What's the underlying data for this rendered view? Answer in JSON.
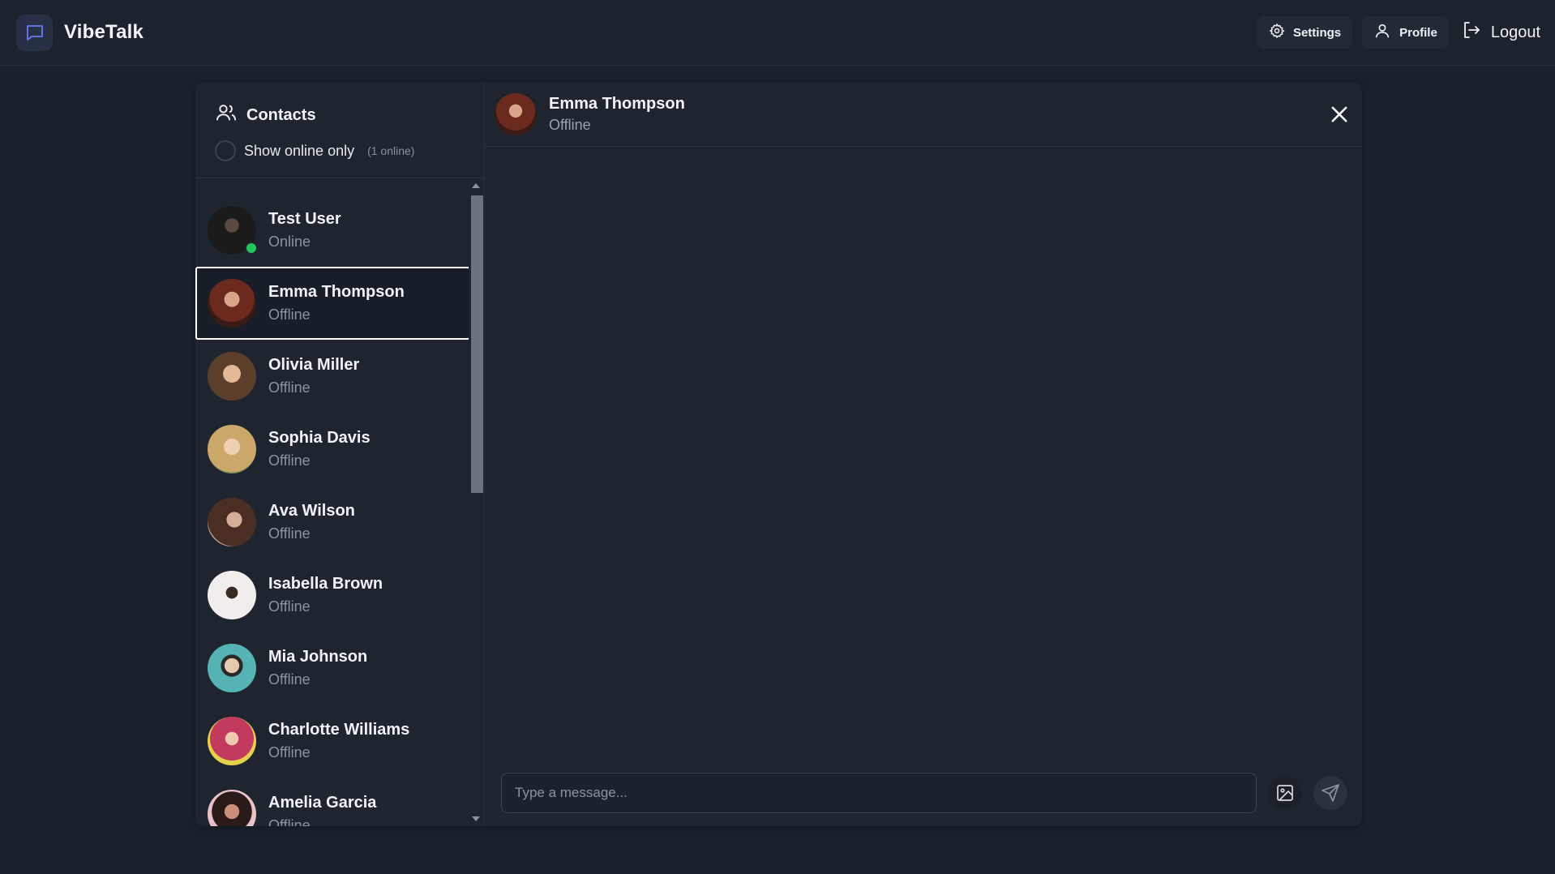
{
  "app": {
    "name": "VibeTalk",
    "accent": "#5b6cf0"
  },
  "nav": {
    "settings_label": "Settings",
    "profile_label": "Profile",
    "logout_label": "Logout"
  },
  "sidebar": {
    "title": "Contacts",
    "filter_label": "Show online only",
    "online_count": "(1 online)",
    "contacts": [
      {
        "name": "Test User",
        "status": "Online",
        "avatar_color": "#2b2b2b",
        "online": true
      },
      {
        "name": "Emma Thompson",
        "status": "Offline",
        "avatar_color": "#7a3a2a",
        "online": false
      },
      {
        "name": "Olivia Miller",
        "status": "Offline",
        "avatar_color": "#8a6a4a",
        "online": false
      },
      {
        "name": "Sophia Davis",
        "status": "Offline",
        "avatar_color": "#c9b07a",
        "online": false
      },
      {
        "name": "Ava Wilson",
        "status": "Offline",
        "avatar_color": "#5a4036",
        "online": false
      },
      {
        "name": "Isabella Brown",
        "status": "Offline",
        "avatar_color": "#e8e2e2",
        "online": false
      },
      {
        "name": "Mia Johnson",
        "status": "Offline",
        "avatar_color": "#4aa7a8",
        "online": false
      },
      {
        "name": "Charlotte Williams",
        "status": "Offline",
        "avatar_color": "#c4486a",
        "online": false
      },
      {
        "name": "Amelia Garcia",
        "status": "Offline",
        "avatar_color": "#d9b3b8",
        "online": false
      }
    ],
    "online_color": "#22c55e"
  },
  "chat": {
    "contact_name": "Emma Thompson",
    "contact_status": "Offline",
    "input_placeholder": "Type a message..."
  }
}
